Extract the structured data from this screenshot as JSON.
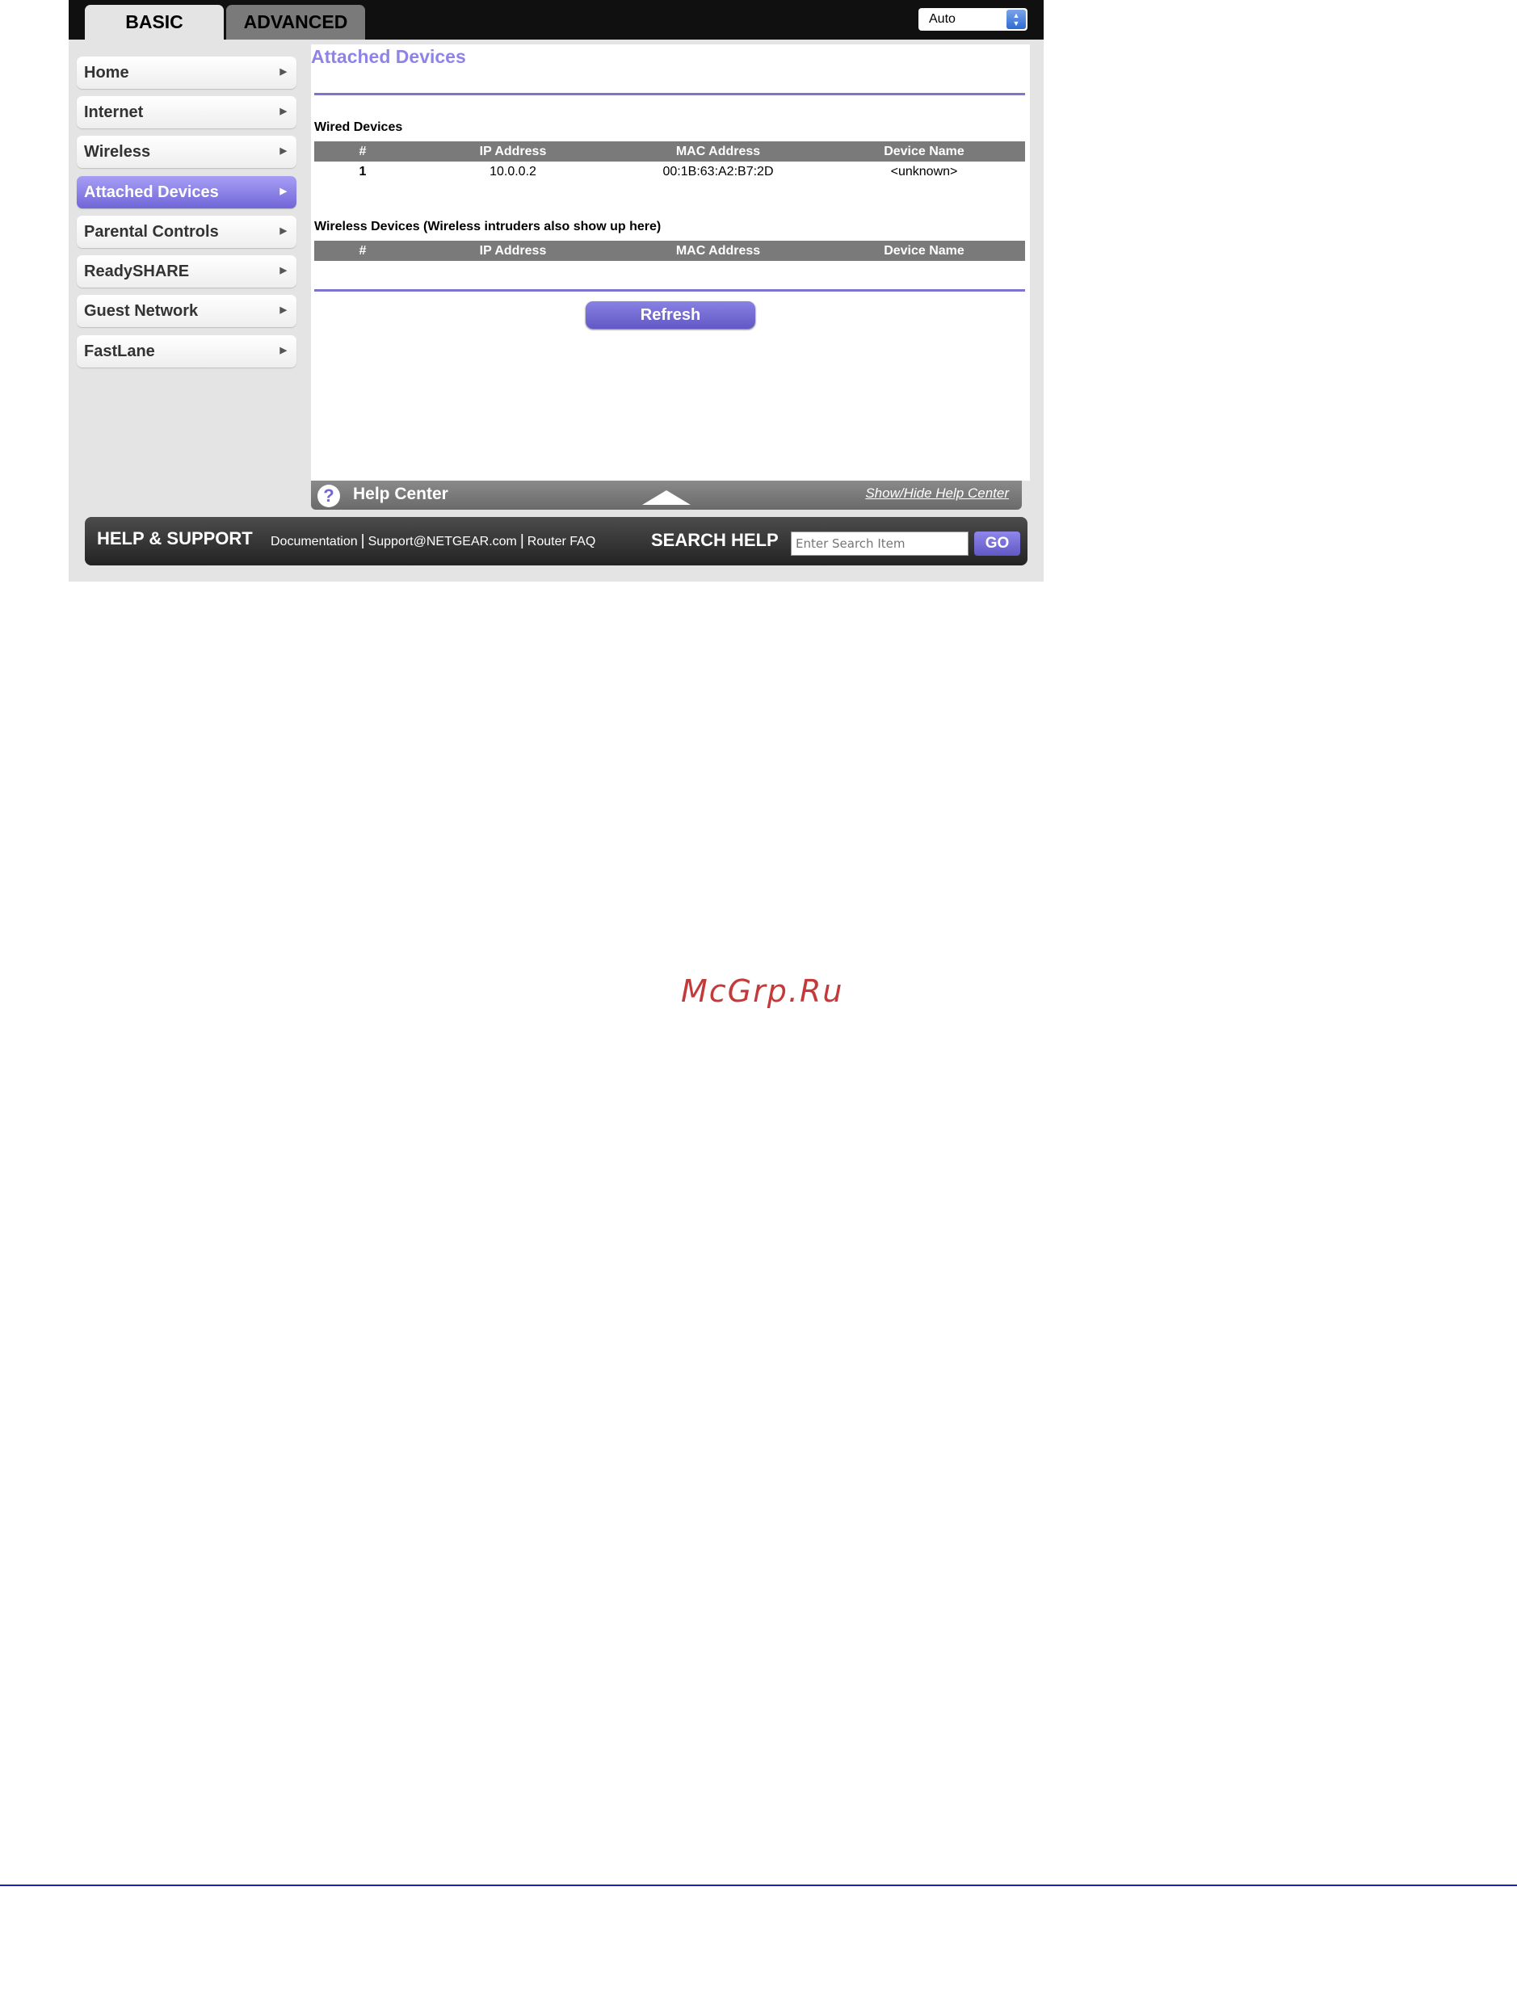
{
  "tabs": {
    "basic": "BASIC",
    "advanced": "ADVANCED"
  },
  "language_select": {
    "value": "Auto"
  },
  "sidebar": {
    "items": [
      {
        "label": "Home"
      },
      {
        "label": "Internet"
      },
      {
        "label": "Wireless"
      },
      {
        "label": "Attached Devices",
        "active": true
      },
      {
        "label": "Parental Controls"
      },
      {
        "label": "ReadySHARE"
      },
      {
        "label": "Guest Network"
      },
      {
        "label": "FastLane"
      }
    ]
  },
  "main": {
    "title": "Attached Devices",
    "wired": {
      "title": "Wired Devices",
      "columns": [
        "#",
        "IP Address",
        "MAC Address",
        "Device Name"
      ],
      "rows": [
        {
          "num": "1",
          "ip": "10.0.0.2",
          "mac": "00:1B:63:A2:B7:2D",
          "name": "<unknown>"
        }
      ]
    },
    "wireless": {
      "title": "Wireless Devices (Wireless intruders also show up here)",
      "columns": [
        "#",
        "IP Address",
        "MAC Address",
        "Device Name"
      ],
      "rows": []
    },
    "refresh_label": "Refresh"
  },
  "help_center": {
    "label": "Help Center",
    "toggle_link": "Show/Hide Help Center"
  },
  "footer": {
    "title": "HELP & SUPPORT",
    "links": [
      "Documentation",
      "Support@NETGEAR.com",
      "Router FAQ"
    ],
    "search_label": "SEARCH HELP",
    "search_placeholder": "Enter Search Item",
    "go_label": "GO"
  },
  "watermark": "McGrp.Ru",
  "colors": {
    "accent": "#7c74cf",
    "title_purple": "#8d84e6",
    "table_header": "#7a7a7a",
    "top_bar": "#101010",
    "watermark": "#c43a3a",
    "page_rule": "#2020c0"
  }
}
